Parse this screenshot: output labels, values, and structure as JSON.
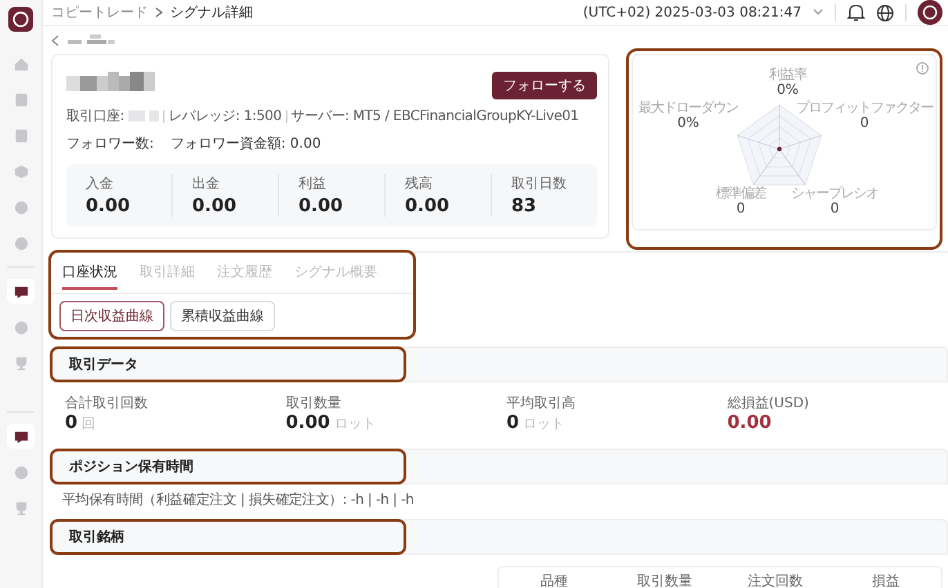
{
  "breadcrumb": [
    "コピートレード",
    "シグナル詳細"
  ],
  "timezone_time": "(UTC+02) 2025-03-03 08:21:47",
  "sidebar": {
    "items": [
      {
        "selected": false
      },
      {
        "selected": false
      },
      {
        "selected": false
      },
      {
        "selected": false
      },
      {
        "selected": false
      },
      {
        "selected": false
      },
      {
        "selected": true
      },
      {
        "selected": false
      },
      {
        "selected": false
      },
      {
        "selected": true
      },
      {
        "selected": false
      },
      {
        "selected": false
      }
    ]
  },
  "profile": {
    "account_label": "取引口座:",
    "leverage": "レバレッジ: 1:500",
    "server": "サーバー: MT5 / EBCFinancialGroupKY-Live01",
    "followers_label": "フォロワー数:",
    "follower_funds": "フォロワー資金額: 0.00",
    "follow_button": "フォローする",
    "stats": [
      {
        "label": "入金",
        "value": "0.00"
      },
      {
        "label": "出金",
        "value": "0.00"
      },
      {
        "label": "利益",
        "value": "0.00"
      },
      {
        "label": "残高",
        "value": "0.00"
      },
      {
        "label": "取引日数",
        "value": "83"
      }
    ]
  },
  "radar": {
    "highlighted": true,
    "metrics": [
      {
        "label": "利益率",
        "value": "0%"
      },
      {
        "label": "最大ドローダウン",
        "value": "0%"
      },
      {
        "label": "プロフィットファクター",
        "value": "0"
      },
      {
        "label": "標準偏差",
        "value": "0"
      },
      {
        "label": "シャープレシオ",
        "value": "0"
      }
    ]
  },
  "tab_panel": {
    "highlighted": true,
    "tabs": [
      {
        "label": "口座状況",
        "selected": true
      },
      {
        "label": "取引詳細",
        "selected": false
      },
      {
        "label": "注文履歴",
        "selected": false
      },
      {
        "label": "シグナル概要",
        "selected": false
      }
    ],
    "chart_buttons": [
      {
        "label": "日次収益曲線",
        "selected": true
      },
      {
        "label": "累積収益曲線",
        "selected": false
      }
    ]
  },
  "trade_data": {
    "title": "取引データ",
    "highlighted": true,
    "stats": [
      {
        "label": "合計取引回数",
        "value": "0",
        "unit": "回",
        "kind": "plain"
      },
      {
        "label": "取引数量",
        "value": "0.00",
        "unit": "ロット",
        "kind": "plain"
      },
      {
        "label": "平均取引高",
        "value": "0",
        "unit": "ロット",
        "kind": "plain"
      },
      {
        "label": "総損益(USD)",
        "value": "0.00",
        "kind": "loss"
      }
    ]
  },
  "holding_time": {
    "title": "ポジション保有時間",
    "highlighted": true,
    "text": "平均保有時間（利益確定注文 | 損失確定注文）: -h | -h | -h"
  },
  "symbols": {
    "title": "取引銘柄",
    "highlighted": true,
    "columns": [
      "品種",
      "取引数量",
      "注文回数",
      "損益"
    ]
  }
}
